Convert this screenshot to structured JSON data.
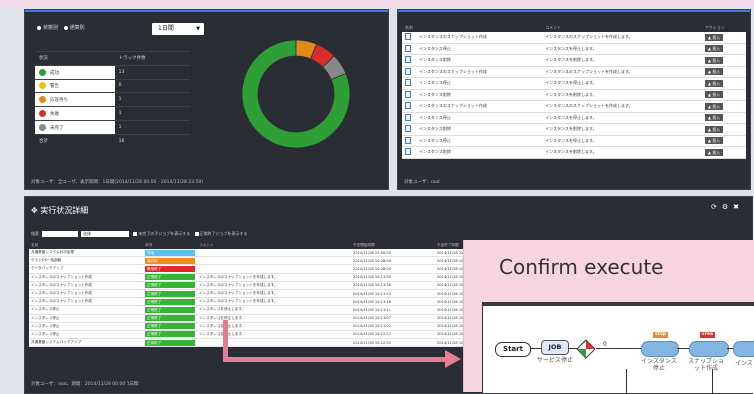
{
  "status_panel": {
    "radio_a": "状態別",
    "radio_b": "通算別",
    "period": "1日間",
    "col_status": "状況",
    "col_count": "トラック件数",
    "rows": [
      {
        "label": "成功",
        "value": "13",
        "color": "#2e9e36"
      },
      {
        "label": "警告",
        "value": "0",
        "color": "#e2c21a"
      },
      {
        "label": "応答待ち",
        "value": "1",
        "color": "#e08a1a"
      },
      {
        "label": "失敗",
        "value": "1",
        "color": "#d92d2d"
      },
      {
        "label": "未完了",
        "value": "1",
        "color": "#888888"
      }
    ],
    "total_label": "合計",
    "total_value": "16",
    "footer": "対象ユーザ：全ユーザ、表示期間：1日間(2014/11/28 00:00 - 2014/11/28 23:59)"
  },
  "chart_data": {
    "type": "pie",
    "categories": [
      "成功",
      "警告",
      "応答待ち",
      "失敗",
      "未完了"
    ],
    "values": [
      13,
      0,
      1,
      1,
      1
    ],
    "colors": [
      "#2e9e36",
      "#e2c21a",
      "#e08a1a",
      "#d92d2d",
      "#888888"
    ],
    "donut": true
  },
  "log_panel": {
    "col_name": "名前",
    "col_comment": "コメント",
    "col_action": "アクション",
    "action_label": "投入",
    "rows": [
      {
        "name": "インスタンスのスナップショット作成",
        "comment": "インスタンスのスナップショットを作成します。"
      },
      {
        "name": "インスタンス停止",
        "comment": "インスタンスを停止します。"
      },
      {
        "name": "インスタンス削除",
        "comment": "インスタンスを削除します。"
      },
      {
        "name": "インスタンスのスナップショット作成",
        "comment": "インスタンスのスナップショットを作成します。"
      },
      {
        "name": "インスタンス停止",
        "comment": "インスタンスを停止します。"
      },
      {
        "name": "インスタンス削除",
        "comment": "インスタンスを削除します。"
      },
      {
        "name": "インスタンスのスナップショット作成",
        "comment": "インスタンスのスナップショットを作成します。"
      },
      {
        "name": "インスタンス停止",
        "comment": "インスタンスを停止します。"
      },
      {
        "name": "インスタンス削除",
        "comment": "インスタンスを削除します。"
      },
      {
        "name": "インスタンス停止",
        "comment": "インスタンスを停止します。"
      },
      {
        "name": "インスタンス削除",
        "comment": "インスタンスを削除します。"
      }
    ],
    "footer": "対象ユーザ：root"
  },
  "exec_panel": {
    "title": "実行状況詳細",
    "search_label": "検索",
    "filter_value": "全体",
    "check_a": "未完了の子ジョブを表示する",
    "check_b": "正常終了ジョブを表示する",
    "headers": [
      "名前",
      "状況",
      "コメント",
      "予定開始時間",
      "予定終了時間",
      "実績開始時間"
    ],
    "rows": [
      {
        "name": "共通基盤システム日次処理",
        "status": "予定",
        "status_color": "#5bc0f0",
        "comment": "",
        "s1": "2014/11/28 22:00:00",
        "s2": "2014/11/28 22:00:01",
        "s3": ""
      },
      {
        "name": "ゲストOS一括起動",
        "status": "実行中",
        "status_color": "#f08a1a",
        "comment": "",
        "s1": "2014/11/28 10:28:09",
        "s2": "2014/11/28 10:28:09",
        "s3": "2014/11/28 10:28:09"
      },
      {
        "name": "データバックアップ",
        "status": "異常終了",
        "status_color": "#e02a2a",
        "comment": "",
        "s1": "2014/11/28 10:28:04",
        "s2": "2014/11/28 10:28:04",
        "s3": "2014/11/28 10:28:04"
      },
      {
        "name": "インスタンスのスナップショット作成",
        "status": "正常終了",
        "status_color": "#35b535",
        "comment": "インスタンスのスナップショットを作成します。",
        "s1": "2014/11/28 10:13:30",
        "s2": "2014/11/28 10:13:30",
        "s3": "2014/11/28 10:13:30"
      },
      {
        "name": "インスタンスのスナップショット作成",
        "status": "正常終了",
        "status_color": "#35b535",
        "comment": "インスタンスのスナップショットを作成します。",
        "s1": "2014/11/28 10:13:26",
        "s2": "2014/11/28 10:13:26",
        "s3": "2014/11/28 10:13:26"
      },
      {
        "name": "インスタンスのスナップショット作成",
        "status": "正常終了",
        "status_color": "#35b535",
        "comment": "インスタンスのスナップショットを作成します。",
        "s1": "2014/11/28 10:13:22",
        "s2": "2014/11/28 10:13:22",
        "s3": "2014/11/28 10:13:22"
      },
      {
        "name": "インスタンスのスナップショット作成",
        "status": "正常終了",
        "status_color": "#35b535",
        "comment": "インスタンスのスナップショットを作成します。",
        "s1": "2014/11/28 10:13:18",
        "s2": "2014/11/28 10:13:18",
        "s3": "2014/11/28 10:13:18"
      },
      {
        "name": "インスタンス停止",
        "status": "正常終了",
        "status_color": "#35b535",
        "comment": "インスタンスを停止します。",
        "s1": "2014/11/28 10:13:11",
        "s2": "2014/11/28 10:13:11",
        "s3": "2014/11/28 10:13:11"
      },
      {
        "name": "インスタンス停止",
        "status": "正常終了",
        "status_color": "#35b535",
        "comment": "インスタンスを停止します。",
        "s1": "2014/11/28 10:13:07",
        "s2": "2014/11/28 10:13:07",
        "s3": "2014/11/28 10:13:07"
      },
      {
        "name": "インスタンス停止",
        "status": "正常終了",
        "status_color": "#35b535",
        "comment": "インスタンスを停止します。",
        "s1": "2014/11/28 10:13:02",
        "s2": "2014/11/28 10:13:02",
        "s3": "2014/11/28 10:13:02"
      },
      {
        "name": "インスタンス停止",
        "status": "正常終了",
        "status_color": "#35b535",
        "comment": "インスタンスを停止します。",
        "s1": "2014/11/28 10:12:57",
        "s2": "2014/11/28 10:12:57",
        "s3": "2014/11/28 10:12:57"
      },
      {
        "name": "共通基盤システムバックアップ",
        "status": "正常終了",
        "status_color": "#35b535",
        "comment": "",
        "s1": "2014/11/28 10:12:53",
        "s2": "2014/11/28 10:12:53",
        "s3": "2014/11/28 10:12:53"
      }
    ],
    "footer": "対象ユーザ：root、期間：2014/11/28 00:00 1日間"
  },
  "confirm": {
    "title": "Confirm execute",
    "start": "Start",
    "job": "JOB",
    "job_caption": "サービス停止",
    "zero": "0",
    "cap1": "インスタンス\n停止",
    "cap2": "スナップショ\nット作成",
    "cap3": "インス",
    "tag1": "stop",
    "tag2": "crea"
  }
}
